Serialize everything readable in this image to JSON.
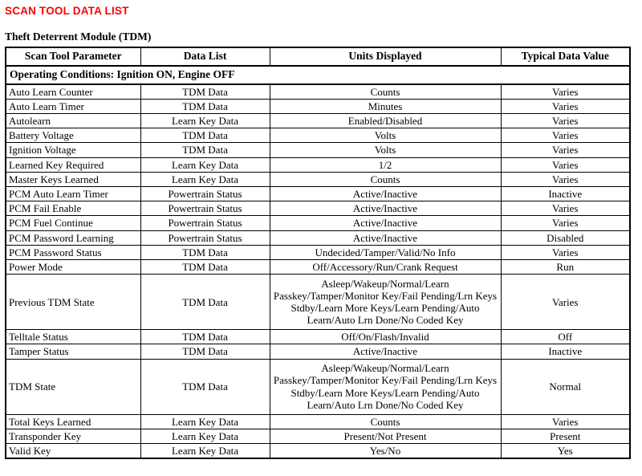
{
  "document": {
    "title": "SCAN TOOL DATA LIST",
    "title_color": "#ff0000",
    "section_title": "Theft Deterrent Module (TDM)"
  },
  "table": {
    "headers": {
      "col1": "Scan Tool Parameter",
      "col2": "Data List",
      "col3": "Units Displayed",
      "col4": "Typical Data Value"
    },
    "condition_row": "Operating Conditions: Ignition ON, Engine OFF",
    "rows": [
      {
        "parameter": "Auto Learn Counter",
        "data_list": "TDM Data",
        "units": "Counts",
        "typical": "Varies"
      },
      {
        "parameter": "Auto Learn Timer",
        "data_list": "TDM Data",
        "units": "Minutes",
        "typical": "Varies"
      },
      {
        "parameter": "Autolearn",
        "data_list": "Learn Key Data",
        "units": "Enabled/Disabled",
        "typical": "Varies"
      },
      {
        "parameter": "Battery Voltage",
        "data_list": "TDM Data",
        "units": "Volts",
        "typical": "Varies"
      },
      {
        "parameter": "Ignition Voltage",
        "data_list": "TDM Data",
        "units": "Volts",
        "typical": "Varies"
      },
      {
        "parameter": "Learned Key Required",
        "data_list": "Learn Key Data",
        "units": "1/2",
        "typical": "Varies"
      },
      {
        "parameter": "Master Keys Learned",
        "data_list": "Learn Key Data",
        "units": "Counts",
        "typical": "Varies"
      },
      {
        "parameter": "PCM Auto Learn Timer",
        "data_list": "Powertrain Status",
        "units": "Active/Inactive",
        "typical": "Inactive"
      },
      {
        "parameter": "PCM Fail Enable",
        "data_list": "Powertrain Status",
        "units": "Active/Inactive",
        "typical": "Varies"
      },
      {
        "parameter": "PCM Fuel Continue",
        "data_list": "Powertrain Status",
        "units": "Active/Inactive",
        "typical": "Varies"
      },
      {
        "parameter": "PCM Password Learning",
        "data_list": "Powertrain Status",
        "units": "Active/Inactive",
        "typical": "Disabled"
      },
      {
        "parameter": "PCM Password Status",
        "data_list": "TDM Data",
        "units": "Undecided/Tamper/Valid/No Info",
        "typical": "Varies"
      },
      {
        "parameter": "Power Mode",
        "data_list": "TDM Data",
        "units": "Off/Accessory/Run/Crank Request",
        "typical": "Run"
      },
      {
        "parameter": "Previous TDM State",
        "data_list": "TDM Data",
        "units_lines": [
          "Asleep/Wakeup/Normal/Learn",
          "Passkey/Tamper/Monitor Key/Fail Pending/Lrn Keys",
          "Stdby/Learn More Keys/Learn Pending/Auto",
          "Learn/Auto Lrn Done/No Coded Key"
        ],
        "typical": "Varies"
      },
      {
        "parameter": "Telltale Status",
        "data_list": "TDM Data",
        "units": "Off/On/Flash/Invalid",
        "typical": "Off"
      },
      {
        "parameter": "Tamper Status",
        "data_list": "TDM Data",
        "units": "Active/Inactive",
        "typical": "Inactive"
      },
      {
        "parameter": "TDM State",
        "data_list": "TDM Data",
        "units_lines": [
          "Asleep/Wakeup/Normal/Learn",
          "Passkey/Tamper/Monitor Key/Fail Pending/Lrn Keys",
          "Stdby/Learn More Keys/Learn Pending/Auto",
          "Learn/Auto Lrn Done/No Coded Key"
        ],
        "typical": "Normal"
      },
      {
        "parameter": "Total Keys Learned",
        "data_list": "Learn Key Data",
        "units": "Counts",
        "typical": "Varies"
      },
      {
        "parameter": "Transponder Key",
        "data_list": "Learn Key Data",
        "units": "Present/Not Present",
        "typical": "Present"
      },
      {
        "parameter": "Valid Key",
        "data_list": "Learn Key Data",
        "units": "Yes/No",
        "typical": "Yes"
      }
    ]
  }
}
